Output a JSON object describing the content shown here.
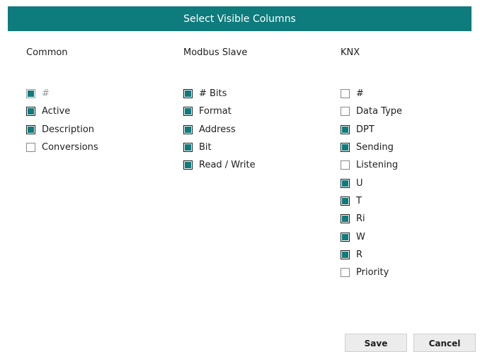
{
  "dialog": {
    "title": "Select Visible Columns"
  },
  "colors": {
    "accent": "#0e7b7d"
  },
  "columns": [
    {
      "header": "Common",
      "items": [
        {
          "label": "#",
          "checked": true,
          "disabled": true
        },
        {
          "label": "Active",
          "checked": true,
          "disabled": false
        },
        {
          "label": "Description",
          "checked": true,
          "disabled": false
        },
        {
          "label": "Conversions",
          "checked": false,
          "disabled": false
        }
      ]
    },
    {
      "header": "Modbus Slave",
      "items": [
        {
          "label": "# Bits",
          "checked": true,
          "disabled": false
        },
        {
          "label": "Format",
          "checked": true,
          "disabled": false
        },
        {
          "label": "Address",
          "checked": true,
          "disabled": false
        },
        {
          "label": "Bit",
          "checked": true,
          "disabled": false
        },
        {
          "label": "Read / Write",
          "checked": true,
          "disabled": false
        }
      ]
    },
    {
      "header": "KNX",
      "items": [
        {
          "label": "#",
          "checked": false,
          "disabled": false
        },
        {
          "label": "Data Type",
          "checked": false,
          "disabled": false
        },
        {
          "label": "DPT",
          "checked": true,
          "disabled": false
        },
        {
          "label": "Sending",
          "checked": true,
          "disabled": false
        },
        {
          "label": "Listening",
          "checked": false,
          "disabled": false
        },
        {
          "label": "U",
          "checked": true,
          "disabled": false
        },
        {
          "label": "T",
          "checked": true,
          "disabled": false
        },
        {
          "label": "Ri",
          "checked": true,
          "disabled": false
        },
        {
          "label": "W",
          "checked": true,
          "disabled": false
        },
        {
          "label": "R",
          "checked": true,
          "disabled": false
        },
        {
          "label": "Priority",
          "checked": false,
          "disabled": false
        }
      ]
    }
  ],
  "buttons": {
    "save_label": "Save",
    "cancel_label": "Cancel"
  }
}
